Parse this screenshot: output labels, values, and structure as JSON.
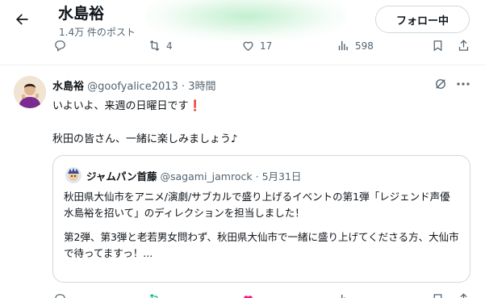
{
  "header": {
    "name": "水島裕",
    "post_count": "1.4万 件のポスト",
    "follow_label": "フォロー中"
  },
  "prev_actions": {
    "retweets": "4",
    "likes": "17",
    "views": "598"
  },
  "post": {
    "author": "水島裕",
    "handle": "@goofyalice2013",
    "dot": "·",
    "time": "3時間",
    "line1": "いよいよ、来週の日曜日です",
    "line1_emoji": "❗",
    "line2": "秋田の皆さん、一緒に楽しみましょう♪",
    "quote": {
      "author": "ジャムパン首藤",
      "handle": "@sagami_jamrock",
      "dot": "·",
      "date": "5月31日",
      "para1": "秋田県大仙市をアニメ/演劇/サブカルで盛り上げるイベントの第1弾「レジェンド声優 水島裕を招いて」のディレクションを担当しました！",
      "para2": "第2弾、第3弾と老若男女問わず、秋田県大仙市で一緒に盛り上げてくださる方、大仙市で待ってますっ！..."
    }
  },
  "colors": {
    "text_primary": "#0f1419",
    "text_secondary": "#536471",
    "border": "#cfd9de",
    "like_active": "#f91880",
    "retweet_active": "#00ba7c",
    "accent": "#1d9bf0"
  },
  "icons": [
    "back-arrow-icon",
    "reply-icon",
    "retweet-icon",
    "like-icon",
    "views-icon",
    "bookmark-icon",
    "share-icon",
    "grok-icon",
    "more-icon"
  ]
}
